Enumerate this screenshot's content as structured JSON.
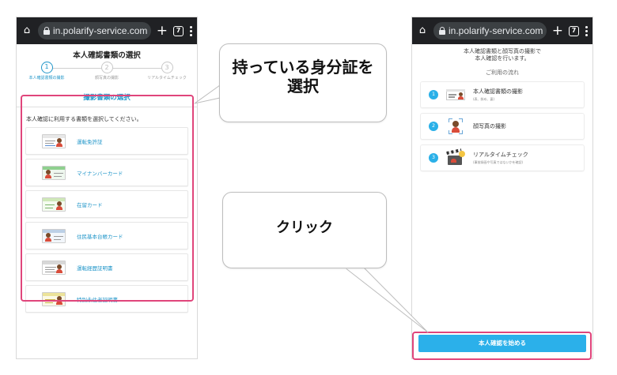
{
  "browser": {
    "url": "in.polarify-service.com",
    "tab_count": "7"
  },
  "left_phone": {
    "page_title": "本人確認書類の選択",
    "steps": [
      {
        "number": "1",
        "label": "本人確認書類の撮影"
      },
      {
        "number": "2",
        "label": "顔写真の撮影"
      },
      {
        "number": "3",
        "label": "リアルタイムチェック"
      }
    ],
    "section_title": "撮影書類の選択",
    "instruction": "本人確認に利用する書類を選択してください。",
    "documents": [
      {
        "label": "運転免許証",
        "icon": "driver-license-card-icon"
      },
      {
        "label": "マイナンバーカード",
        "icon": "mynumber-card-icon"
      },
      {
        "label": "在留カード",
        "icon": "residence-card-icon"
      },
      {
        "label": "住民基本台帳カード",
        "icon": "resident-register-card-icon"
      },
      {
        "label": "運転経歴証明書",
        "icon": "driving-history-card-icon"
      },
      {
        "label": "特別永住者証明書",
        "icon": "special-permanent-resident-card-icon"
      }
    ]
  },
  "right_phone": {
    "intro_line1": "本人確認書類と顔写真の撮影で",
    "intro_line2": "本人確認を行います。",
    "flow_title": "ご利用の流れ",
    "flow": [
      {
        "number": "1",
        "title": "本人確認書類の撮影",
        "sub": "(表、斜め、裏)",
        "icon": "id-card-icon"
      },
      {
        "number": "2",
        "title": "顔写真の撮影",
        "sub": "",
        "icon": "face-scan-icon"
      },
      {
        "number": "3",
        "title": "リアルタイムチェック",
        "sub": "(事前録画や写真ではないかを確認)",
        "icon": "clapperboard-icon"
      }
    ],
    "start_button": "本人確認を始める"
  },
  "callouts": {
    "select_line1": "持っている身分証を",
    "select_line2": "選択",
    "click": "クリック"
  },
  "colors": {
    "accent_blue": "#2196c9",
    "button_blue": "#2bb0ea",
    "highlight_pink": "#e0457b",
    "browser_bar": "#202124"
  }
}
